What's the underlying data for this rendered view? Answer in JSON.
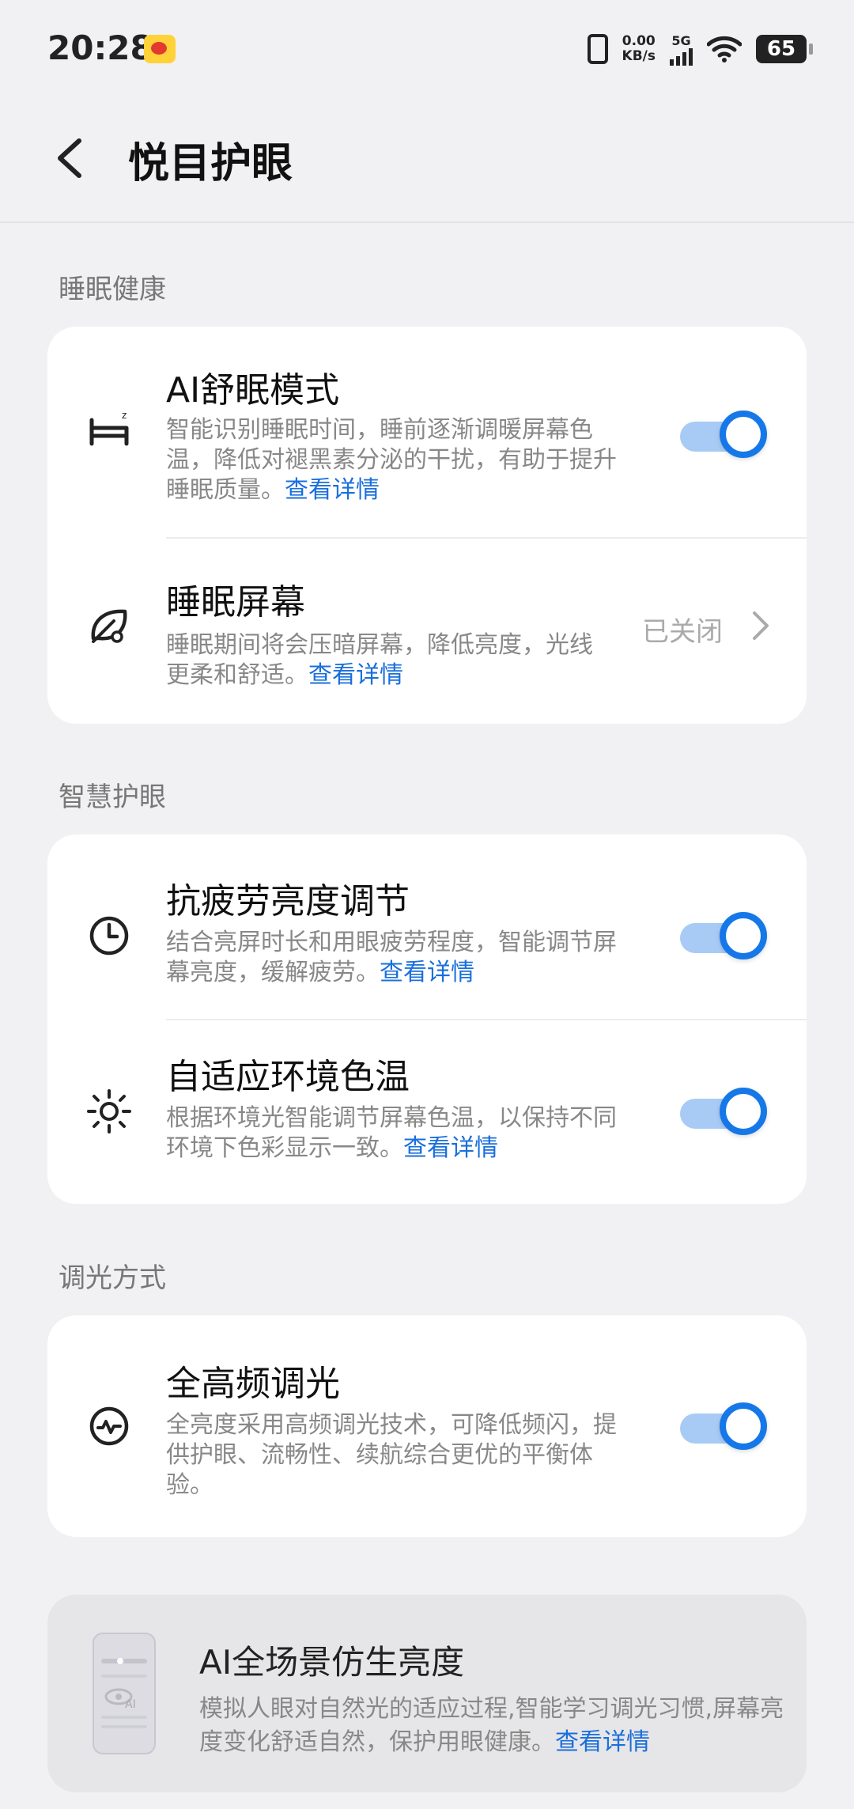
{
  "status_bar": {
    "time": "20:28",
    "speed_value": "0.00",
    "speed_unit": "KB/s",
    "network": "5G",
    "battery": "65"
  },
  "header": {
    "title": "悦目护眼"
  },
  "sections": {
    "sleep": {
      "label": "睡眠健康",
      "ai_sleep": {
        "title": "AI舒眠模式",
        "desc": "智能识别睡眠时间，睡前逐渐调暖屏幕色温，降低对褪黑素分泌的干扰，有助于提升睡眠质量。",
        "link": "查看详情",
        "enabled": true
      },
      "sleep_screen": {
        "title": "睡眠屏幕",
        "desc": "睡眠期间将会压暗屏幕，降低亮度，光线更柔和舒适。",
        "link": "查看详情",
        "status": "已关闭"
      }
    },
    "smart": {
      "label": "智慧护眼",
      "anti_fatigue": {
        "title": "抗疲劳亮度调节",
        "desc": "结合亮屏时长和用眼疲劳程度，智能调节屏幕亮度，缓解疲劳。",
        "link": "查看详情",
        "enabled": true
      },
      "adaptive_color": {
        "title": "自适应环境色温",
        "desc": "根据环境光智能调节屏幕色温，以保持不同环境下色彩显示一致。",
        "link": "查看详情",
        "enabled": true
      }
    },
    "dimming": {
      "label": "调光方式",
      "high_freq": {
        "title": "全高频调光",
        "desc": "全亮度采用高频调光技术，可降低频闪，提供护眼、流畅性、续航综合更优的平衡体验。",
        "enabled": true
      }
    }
  },
  "promo": {
    "title": "AI全场景仿生亮度",
    "desc": "模拟人眼对自然光的适应过程,智能学习调光习惯,屏幕亮度变化舒适自然，保护用眼健康。",
    "link": "查看详情",
    "illus_label": "AI"
  },
  "colors": {
    "accent": "#1678e8",
    "track": "#a8cbf5",
    "background": "#f1f1f3"
  }
}
